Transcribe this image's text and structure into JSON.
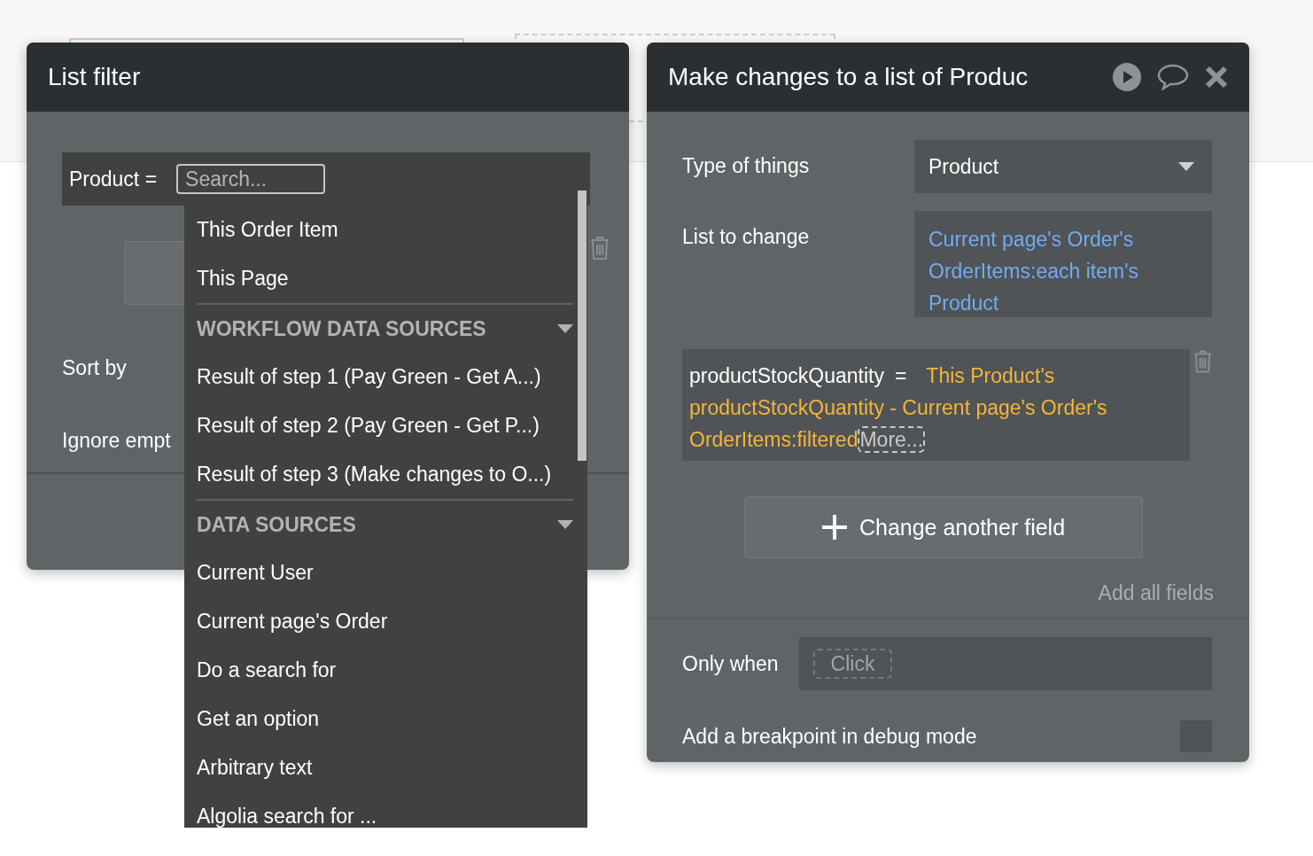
{
  "list_filter": {
    "title": "List filter",
    "filter": {
      "label": "Product =",
      "search": {
        "placeholder": "Search..."
      }
    },
    "rows": [
      {
        "label": "Sort by"
      },
      {
        "label": "Ignore empt"
      }
    ],
    "dropdown": [
      {
        "kind": "item",
        "label": "This Order Item"
      },
      {
        "kind": "item",
        "label": "This Page"
      },
      {
        "kind": "section",
        "label": "WORKFLOW DATA SOURCES"
      },
      {
        "kind": "item",
        "label": "Result of step 1 (Pay Green - Get A...)"
      },
      {
        "kind": "item",
        "label": "Result of step 2 (Pay Green - Get P...)"
      },
      {
        "kind": "item",
        "label": "Result of step 3 (Make changes to O...)"
      },
      {
        "kind": "section",
        "label": "DATA SOURCES"
      },
      {
        "kind": "item",
        "label": "Current User"
      },
      {
        "kind": "item",
        "label": "Current page's Order"
      },
      {
        "kind": "item",
        "label": "Do a search for"
      },
      {
        "kind": "item",
        "label": "Get an option"
      },
      {
        "kind": "item",
        "label": "Arbitrary text"
      },
      {
        "kind": "item",
        "label": "Algolia search for ..."
      }
    ]
  },
  "action": {
    "title": "Make changes to a list of Produc",
    "type_of_things": {
      "label": "Type of things",
      "value": "Product"
    },
    "list_to_change": {
      "label": "List to change",
      "value": "Current page's Order's OrderItems:each item's Product"
    },
    "changes": [
      {
        "field": "productStockQuantity",
        "operator": "=",
        "value": "This Product's productStockQuantity - Current page's Order's OrderItems:filtered",
        "more": "More..."
      }
    ],
    "add_button": "Change another field",
    "add_all": "Add all fields",
    "only_when": {
      "label": "Only when",
      "placeholder": "Click"
    },
    "breakpoint": {
      "label": "Add a breakpoint in debug mode",
      "checked": false
    }
  }
}
